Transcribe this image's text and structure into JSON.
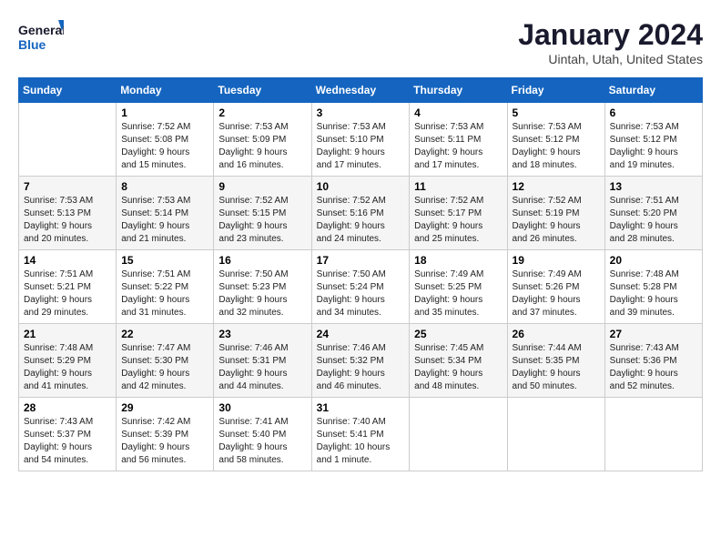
{
  "header": {
    "logo_general": "General",
    "logo_blue": "Blue",
    "month": "January 2024",
    "location": "Uintah, Utah, United States"
  },
  "days_of_week": [
    "Sunday",
    "Monday",
    "Tuesday",
    "Wednesday",
    "Thursday",
    "Friday",
    "Saturday"
  ],
  "weeks": [
    [
      {
        "day": "",
        "info": ""
      },
      {
        "day": "1",
        "info": "Sunrise: 7:52 AM\nSunset: 5:08 PM\nDaylight: 9 hours\nand 15 minutes."
      },
      {
        "day": "2",
        "info": "Sunrise: 7:53 AM\nSunset: 5:09 PM\nDaylight: 9 hours\nand 16 minutes."
      },
      {
        "day": "3",
        "info": "Sunrise: 7:53 AM\nSunset: 5:10 PM\nDaylight: 9 hours\nand 17 minutes."
      },
      {
        "day": "4",
        "info": "Sunrise: 7:53 AM\nSunset: 5:11 PM\nDaylight: 9 hours\nand 17 minutes."
      },
      {
        "day": "5",
        "info": "Sunrise: 7:53 AM\nSunset: 5:12 PM\nDaylight: 9 hours\nand 18 minutes."
      },
      {
        "day": "6",
        "info": "Sunrise: 7:53 AM\nSunset: 5:12 PM\nDaylight: 9 hours\nand 19 minutes."
      }
    ],
    [
      {
        "day": "7",
        "info": "Sunrise: 7:53 AM\nSunset: 5:13 PM\nDaylight: 9 hours\nand 20 minutes."
      },
      {
        "day": "8",
        "info": "Sunrise: 7:53 AM\nSunset: 5:14 PM\nDaylight: 9 hours\nand 21 minutes."
      },
      {
        "day": "9",
        "info": "Sunrise: 7:52 AM\nSunset: 5:15 PM\nDaylight: 9 hours\nand 23 minutes."
      },
      {
        "day": "10",
        "info": "Sunrise: 7:52 AM\nSunset: 5:16 PM\nDaylight: 9 hours\nand 24 minutes."
      },
      {
        "day": "11",
        "info": "Sunrise: 7:52 AM\nSunset: 5:17 PM\nDaylight: 9 hours\nand 25 minutes."
      },
      {
        "day": "12",
        "info": "Sunrise: 7:52 AM\nSunset: 5:19 PM\nDaylight: 9 hours\nand 26 minutes."
      },
      {
        "day": "13",
        "info": "Sunrise: 7:51 AM\nSunset: 5:20 PM\nDaylight: 9 hours\nand 28 minutes."
      }
    ],
    [
      {
        "day": "14",
        "info": "Sunrise: 7:51 AM\nSunset: 5:21 PM\nDaylight: 9 hours\nand 29 minutes."
      },
      {
        "day": "15",
        "info": "Sunrise: 7:51 AM\nSunset: 5:22 PM\nDaylight: 9 hours\nand 31 minutes."
      },
      {
        "day": "16",
        "info": "Sunrise: 7:50 AM\nSunset: 5:23 PM\nDaylight: 9 hours\nand 32 minutes."
      },
      {
        "day": "17",
        "info": "Sunrise: 7:50 AM\nSunset: 5:24 PM\nDaylight: 9 hours\nand 34 minutes."
      },
      {
        "day": "18",
        "info": "Sunrise: 7:49 AM\nSunset: 5:25 PM\nDaylight: 9 hours\nand 35 minutes."
      },
      {
        "day": "19",
        "info": "Sunrise: 7:49 AM\nSunset: 5:26 PM\nDaylight: 9 hours\nand 37 minutes."
      },
      {
        "day": "20",
        "info": "Sunrise: 7:48 AM\nSunset: 5:28 PM\nDaylight: 9 hours\nand 39 minutes."
      }
    ],
    [
      {
        "day": "21",
        "info": "Sunrise: 7:48 AM\nSunset: 5:29 PM\nDaylight: 9 hours\nand 41 minutes."
      },
      {
        "day": "22",
        "info": "Sunrise: 7:47 AM\nSunset: 5:30 PM\nDaylight: 9 hours\nand 42 minutes."
      },
      {
        "day": "23",
        "info": "Sunrise: 7:46 AM\nSunset: 5:31 PM\nDaylight: 9 hours\nand 44 minutes."
      },
      {
        "day": "24",
        "info": "Sunrise: 7:46 AM\nSunset: 5:32 PM\nDaylight: 9 hours\nand 46 minutes."
      },
      {
        "day": "25",
        "info": "Sunrise: 7:45 AM\nSunset: 5:34 PM\nDaylight: 9 hours\nand 48 minutes."
      },
      {
        "day": "26",
        "info": "Sunrise: 7:44 AM\nSunset: 5:35 PM\nDaylight: 9 hours\nand 50 minutes."
      },
      {
        "day": "27",
        "info": "Sunrise: 7:43 AM\nSunset: 5:36 PM\nDaylight: 9 hours\nand 52 minutes."
      }
    ],
    [
      {
        "day": "28",
        "info": "Sunrise: 7:43 AM\nSunset: 5:37 PM\nDaylight: 9 hours\nand 54 minutes."
      },
      {
        "day": "29",
        "info": "Sunrise: 7:42 AM\nSunset: 5:39 PM\nDaylight: 9 hours\nand 56 minutes."
      },
      {
        "day": "30",
        "info": "Sunrise: 7:41 AM\nSunset: 5:40 PM\nDaylight: 9 hours\nand 58 minutes."
      },
      {
        "day": "31",
        "info": "Sunrise: 7:40 AM\nSunset: 5:41 PM\nDaylight: 10 hours\nand 1 minute."
      },
      {
        "day": "",
        "info": ""
      },
      {
        "day": "",
        "info": ""
      },
      {
        "day": "",
        "info": ""
      }
    ]
  ]
}
